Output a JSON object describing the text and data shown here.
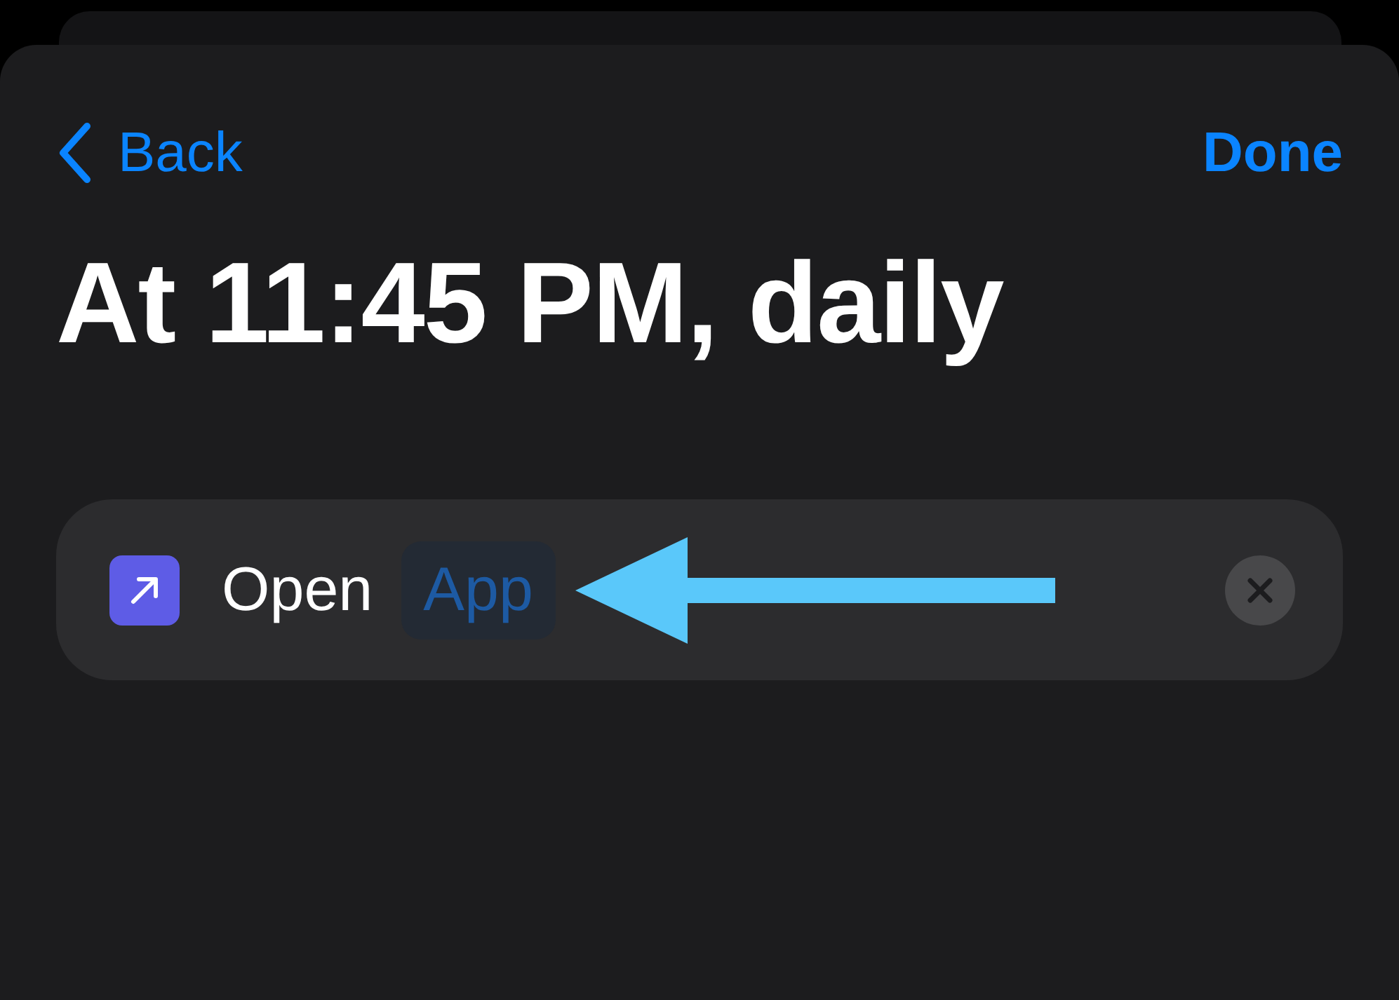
{
  "navigation": {
    "back_label": "Back",
    "done_label": "Done"
  },
  "title": "At 11:45 PM, daily",
  "action": {
    "verb": "Open",
    "parameter": "App"
  }
}
